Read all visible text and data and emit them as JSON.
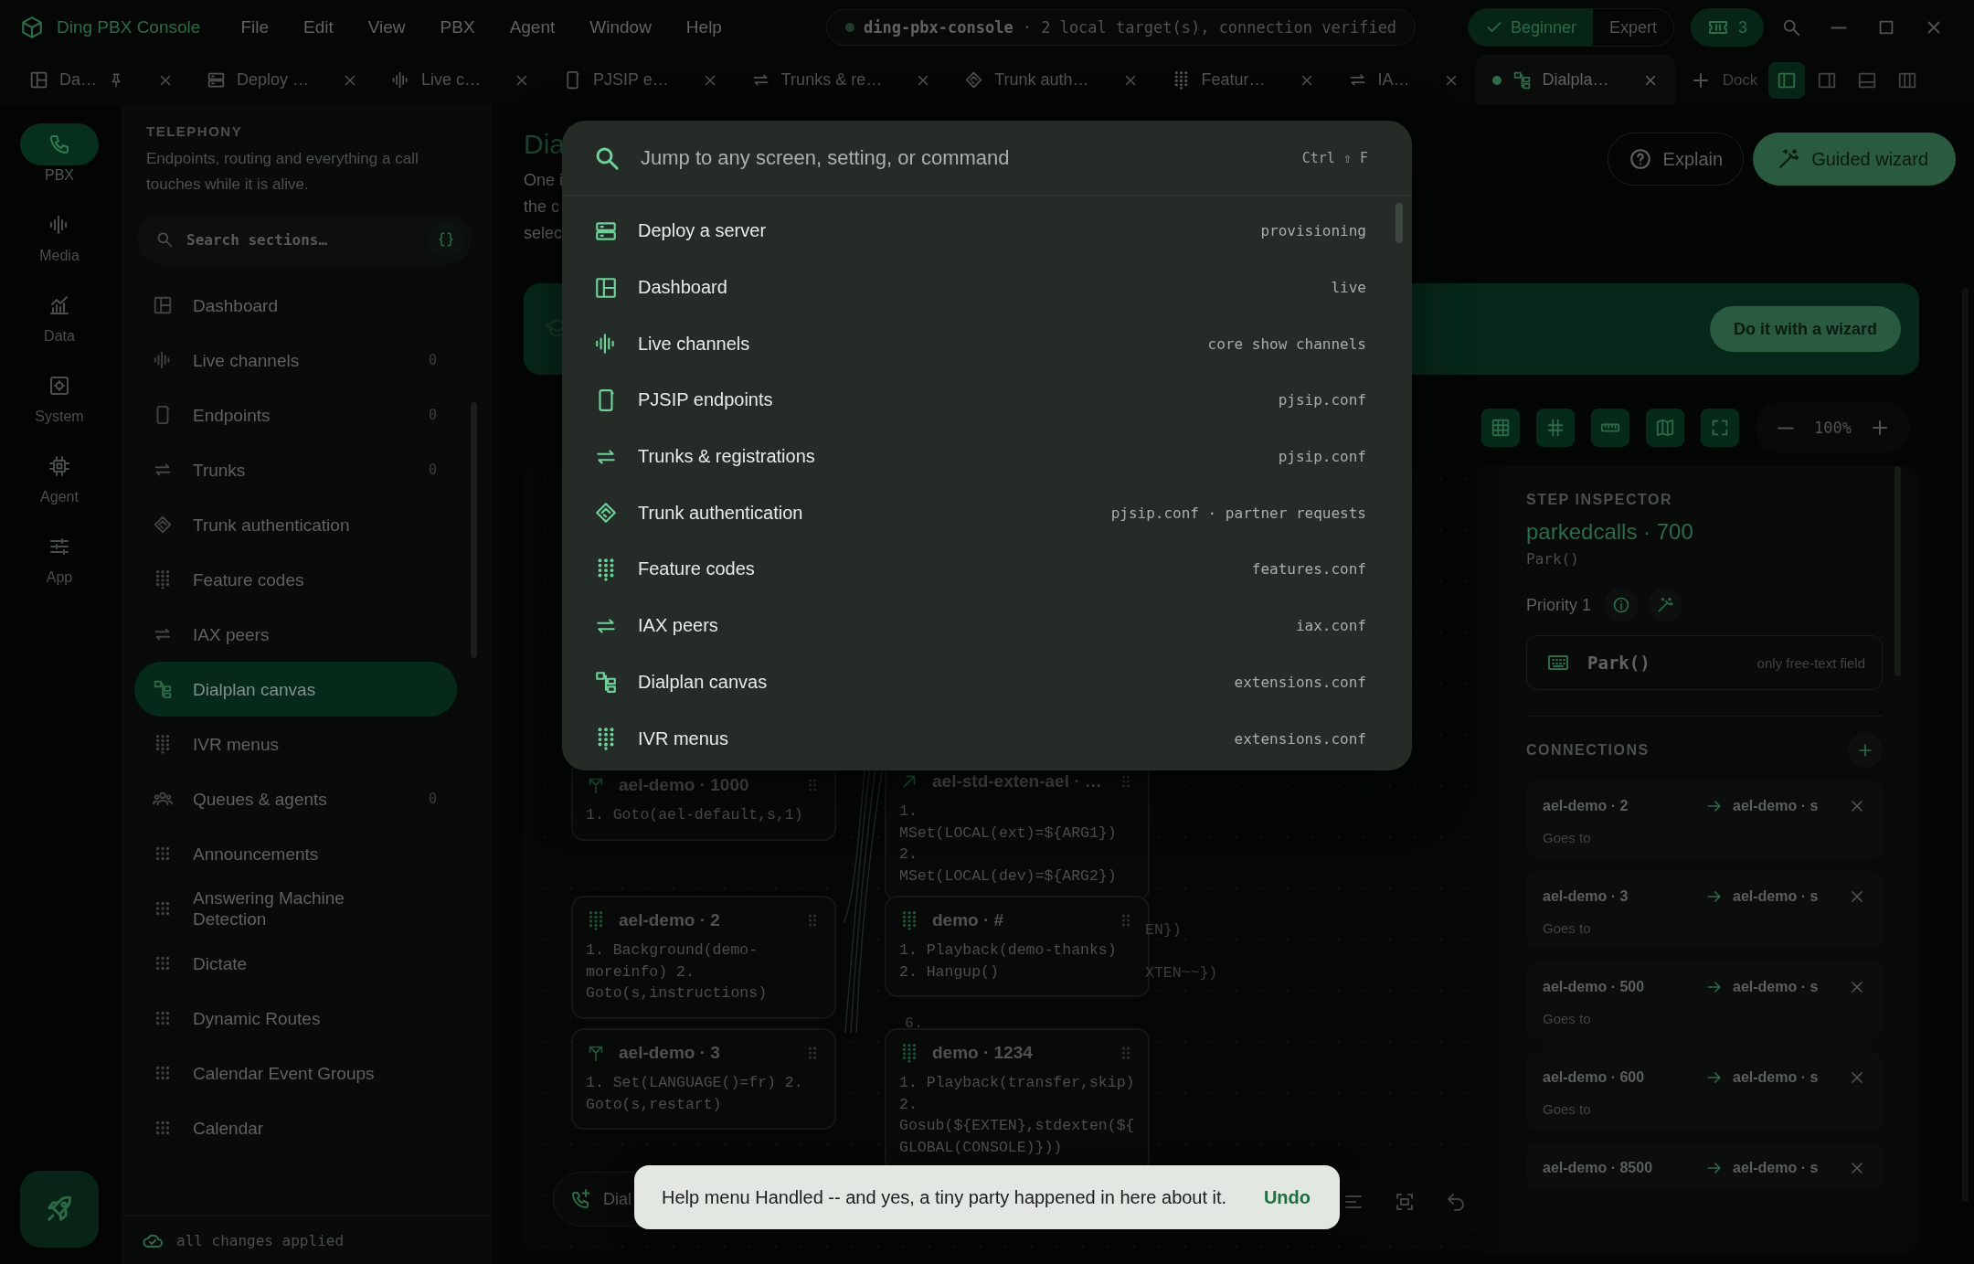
{
  "app": {
    "title": "Ding PBX Console"
  },
  "menu": [
    "File",
    "Edit",
    "View",
    "PBX",
    "Agent",
    "Window",
    "Help"
  ],
  "connection": {
    "host": "ding-pbx-console",
    "status": "· 2 local target(s), connection verified",
    "online": true
  },
  "modes": [
    {
      "label": "Beginner",
      "selected": true
    },
    {
      "label": "Expert",
      "selected": false
    }
  ],
  "tickets": "3",
  "tabs": [
    {
      "label": "Da…",
      "kind": "layout",
      "pinned": true,
      "selected": false
    },
    {
      "label": "Deploy …",
      "kind": "server",
      "pinned": false,
      "selected": false
    },
    {
      "label": "Live c…",
      "kind": "waveform",
      "pinned": false,
      "selected": false
    },
    {
      "label": "PJSIP e…",
      "kind": "device",
      "pinned": false,
      "selected": false
    },
    {
      "label": "Trunks & re…",
      "kind": "swap",
      "pinned": false,
      "selected": false
    },
    {
      "label": "Trunk auth…",
      "kind": "handshake",
      "pinned": false,
      "selected": false
    },
    {
      "label": "Featur…",
      "kind": "dialpad",
      "pinned": false,
      "selected": false
    },
    {
      "label": "IA…",
      "kind": "swap",
      "pinned": false,
      "selected": false
    },
    {
      "label": "Dialpla…",
      "kind": "flowchart",
      "pinned": false,
      "selected": true
    }
  ],
  "dock": {
    "label": "Dock",
    "layouts": [
      {
        "kind": "left",
        "selected": true
      },
      {
        "kind": "right",
        "selected": false
      },
      {
        "kind": "bottom",
        "selected": false
      },
      {
        "kind": "columns",
        "selected": false
      }
    ]
  },
  "rail": [
    {
      "label": "PBX",
      "kind": "phone",
      "selected": true
    },
    {
      "label": "Media",
      "kind": "waveform",
      "selected": false
    },
    {
      "label": "Data",
      "kind": "chart",
      "selected": false
    },
    {
      "label": "System",
      "kind": "gear",
      "selected": false
    },
    {
      "label": "Agent",
      "kind": "chip",
      "selected": false
    },
    {
      "label": "App",
      "kind": "sliders",
      "selected": false
    }
  ],
  "sidebar": {
    "heading": "TELEPHONY",
    "description": "Endpoints, routing and everything a call touches while it is alive.",
    "search": {
      "placeholder": "Search sections…"
    },
    "items": [
      {
        "label": "Dashboard",
        "kind": "layout",
        "selected": false
      },
      {
        "label": "Live channels",
        "kind": "waveform",
        "count": "0",
        "selected": false
      },
      {
        "label": "Endpoints",
        "kind": "device",
        "count": "0",
        "selected": false
      },
      {
        "label": "Trunks",
        "kind": "swap",
        "count": "0",
        "selected": false
      },
      {
        "label": "Trunk authentication",
        "kind": "handshake",
        "selected": false
      },
      {
        "label": "Feature codes",
        "kind": "dialpad",
        "selected": false
      },
      {
        "label": "IAX peers",
        "kind": "swap",
        "selected": false
      },
      {
        "label": "Dialplan canvas",
        "kind": "flowchart",
        "selected": true
      },
      {
        "label": "IVR menus",
        "kind": "dialpad",
        "selected": false
      },
      {
        "label": "Queues & agents",
        "kind": "people",
        "count": "0",
        "selected": false
      },
      {
        "label": "Announcements",
        "kind": "grid",
        "selected": false
      },
      {
        "label": "Answering Machine Detection",
        "kind": "grid",
        "selected": false
      },
      {
        "label": "Dictate",
        "kind": "grid",
        "selected": false
      },
      {
        "label": "Dynamic Routes",
        "kind": "grid",
        "selected": false
      },
      {
        "label": "Calendar Event Groups",
        "kind": "grid",
        "selected": false
      },
      {
        "label": "Calendar",
        "kind": "grid",
        "selected": false
      }
    ],
    "footer": "all changes applied"
  },
  "page": {
    "title": "Dia",
    "description": [
      "One i",
      "the c",
      "selec"
    ],
    "actions": [
      {
        "label": "Explain",
        "kind": "outline"
      },
      {
        "label": "Guided wizard",
        "kind": "primary"
      }
    ],
    "banner_action": "Do it with a wizard",
    "tools": [
      {
        "kind": "table",
        "on": true
      },
      {
        "kind": "hash",
        "on": true
      },
      {
        "kind": "ruler",
        "on": true
      },
      {
        "kind": "map",
        "on": true
      },
      {
        "kind": "fullscreen",
        "on": true
      }
    ],
    "zoom": "100%"
  },
  "canvas": {
    "nodes": [
      {
        "title": "ael-demo · 1000",
        "kind": "branch",
        "steps": "1. Goto(ael-default,s,1)"
      },
      {
        "title": "ael-std-exten-ael · …",
        "kind": "arrow",
        "steps": "1. MSet(LOCAL(ext)=${ARG1}) 2. MSet(LOCAL(dev)=${ARG2})"
      },
      {
        "title": "ael-demo · 2",
        "kind": "dialpad",
        "steps": "1. Background(demo-moreinfo) 2. Goto(s,instructions)"
      },
      {
        "title": "demo · #",
        "kind": "dialpad",
        "steps": "1. Playback(demo-thanks) 2. Hangup()"
      },
      {
        "title": "ael-demo · 3",
        "kind": "branch",
        "steps": "1. Set(LANGUAGE()=fr) 2. Goto(s,restart)"
      },
      {
        "title": "demo · 1234",
        "kind": "dialpad",
        "steps": "1. Playback(transfer,skip) 2. Gosub(${EXTEN},stdexten(${GLOBAL(CONSOLE)}))"
      }
    ],
    "fragments": [
      "EN})",
      "XTEN~~})",
      "6."
    ],
    "dial": "Dial"
  },
  "inspector": {
    "heading": "STEP INSPECTOR",
    "title": "parkedcalls · 700",
    "application": "Park()",
    "priority": "Priority 1",
    "field": {
      "value": "Park()",
      "hint": "only free-text field"
    },
    "connections_heading": "CONNECTIONS",
    "connections": [
      {
        "from": "ael-demo · 2",
        "to": "ael-demo · s",
        "label": "Goes to"
      },
      {
        "from": "ael-demo · 3",
        "to": "ael-demo · s",
        "label": "Goes to"
      },
      {
        "from": "ael-demo · 500",
        "to": "ael-demo · s",
        "label": "Goes to"
      },
      {
        "from": "ael-demo · 600",
        "to": "ael-demo · s",
        "label": "Goes to"
      },
      {
        "from": "ael-demo · 8500",
        "to": "ael-demo · s"
      }
    ]
  },
  "palette": {
    "placeholder": "Jump to any screen, setting, or command",
    "shortcut": "Ctrl ⇧ F",
    "results": [
      {
        "label": "Deploy a server",
        "hint": "provisioning",
        "kind": "server"
      },
      {
        "label": "Dashboard",
        "hint": "live",
        "kind": "layout"
      },
      {
        "label": "Live channels",
        "hint": "core show channels",
        "kind": "waveform"
      },
      {
        "label": "PJSIP endpoints",
        "hint": "pjsip.conf",
        "kind": "device"
      },
      {
        "label": "Trunks & registrations",
        "hint": "pjsip.conf",
        "kind": "swap"
      },
      {
        "label": "Trunk authentication",
        "hint": "pjsip.conf · partner requests",
        "kind": "handshake"
      },
      {
        "label": "Feature codes",
        "hint": "features.conf",
        "kind": "dialpad"
      },
      {
        "label": "IAX peers",
        "hint": "iax.conf",
        "kind": "swap"
      },
      {
        "label": "Dialplan canvas",
        "hint": "extensions.conf",
        "kind": "flowchart"
      },
      {
        "label": "IVR menus",
        "hint": "extensions.conf",
        "kind": "dialpad"
      }
    ]
  },
  "toast": {
    "message": "Help menu Handled -- and yes, a tiny party happened in here about it.",
    "action": "Undo"
  }
}
